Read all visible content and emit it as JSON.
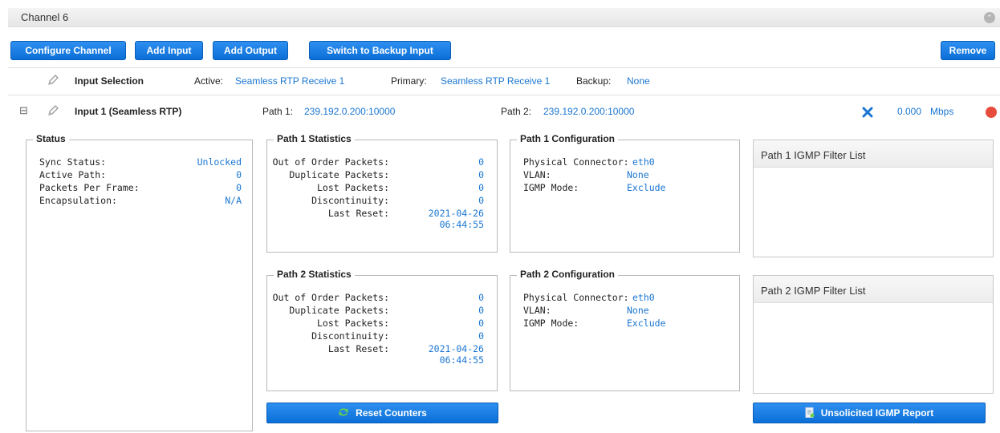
{
  "channel": {
    "title": "Channel 6"
  },
  "toolbar": {
    "configure_channel": "Configure Channel",
    "add_input": "Add Input",
    "add_output": "Add Output",
    "switch_backup": "Switch to Backup Input",
    "remove": "Remove"
  },
  "input_selection": {
    "label": "Input Selection",
    "active_label": "Active:",
    "active_value": "Seamless RTP Receive 1",
    "primary_label": "Primary:",
    "primary_value": "Seamless RTP Receive 1",
    "backup_label": "Backup:",
    "backup_value": "None"
  },
  "input": {
    "expand_glyph": "⊟",
    "title": "Input 1 (Seamless RTP)",
    "path1_label": "Path 1:",
    "path1_value": "239.192.0.200:10000",
    "path2_label": "Path 2:",
    "path2_value": "239.192.0.200:10000",
    "bitrate": "0.000",
    "bitrate_unit": "Mbps",
    "status_color": "#e74c3c"
  },
  "status": {
    "legend": "Status",
    "rows": [
      {
        "key": "Sync Status:",
        "value": "Unlocked"
      },
      {
        "key": "Active Path:",
        "value": "0"
      },
      {
        "key": "Packets Per Frame:",
        "value": "0"
      },
      {
        "key": "Encapsulation:",
        "value": "N/A"
      }
    ]
  },
  "path1_stats": {
    "legend": "Path 1 Statistics",
    "rows": [
      {
        "key": "Out of Order Packets:",
        "value": "0"
      },
      {
        "key": "Duplicate Packets:",
        "value": "0"
      },
      {
        "key": "Lost Packets:",
        "value": "0"
      },
      {
        "key": "Discontinuity:",
        "value": "0"
      }
    ],
    "last_reset_label": "Last Reset:",
    "last_reset_date": "2021-04-26",
    "last_reset_time": "06:44:55"
  },
  "path2_stats": {
    "legend": "Path 2 Statistics",
    "rows": [
      {
        "key": "Out of Order Packets:",
        "value": "0"
      },
      {
        "key": "Duplicate Packets:",
        "value": "0"
      },
      {
        "key": "Lost Packets:",
        "value": "0"
      },
      {
        "key": "Discontinuity:",
        "value": "0"
      }
    ],
    "last_reset_label": "Last Reset:",
    "last_reset_date": "2021-04-26",
    "last_reset_time": "06:44:55"
  },
  "path1_config": {
    "legend": "Path 1 Configuration",
    "rows": [
      {
        "key": "Physical Connector:",
        "value": "eth0"
      },
      {
        "key": "VLAN:",
        "value": "None"
      },
      {
        "key": "IGMP Mode:",
        "value": "Exclude"
      }
    ]
  },
  "path2_config": {
    "legend": "Path 2 Configuration",
    "rows": [
      {
        "key": "Physical Connector:",
        "value": "eth0"
      },
      {
        "key": "VLAN:",
        "value": "None"
      },
      {
        "key": "IGMP Mode:",
        "value": "Exclude"
      }
    ]
  },
  "igmp1": {
    "title": "Path 1 IGMP Filter List"
  },
  "igmp2": {
    "title": "Path 2 IGMP Filter List"
  },
  "actions": {
    "reset_counters": "Reset Counters",
    "unsolicited_igmp": "Unsolicited IGMP Report"
  }
}
